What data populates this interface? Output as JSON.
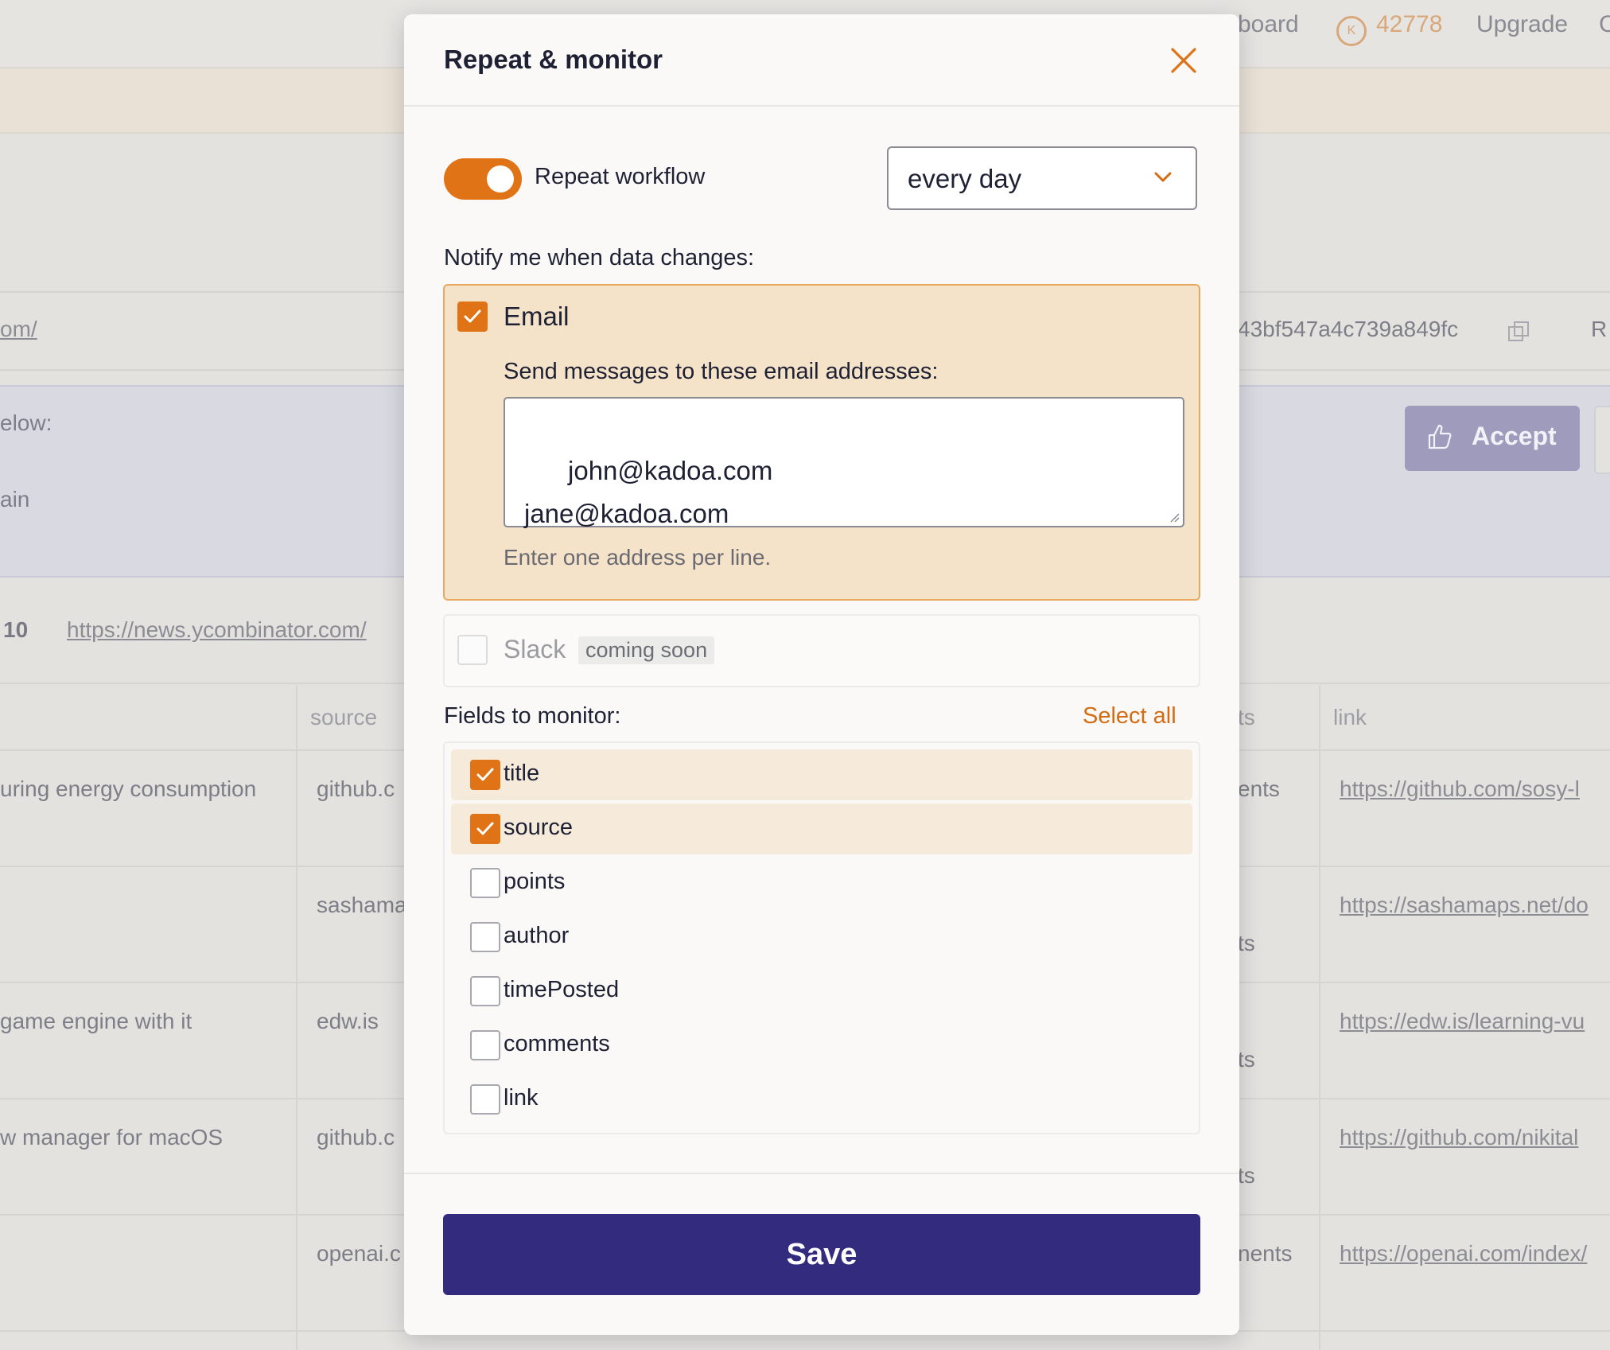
{
  "background": {
    "nav": {
      "dashboard_fragment": "board",
      "credits": "42778",
      "upgrade": "Upgrade",
      "edge_fragment": "C"
    },
    "url_fragment": "om/",
    "id_fragment": "43bf547a4c739a849fc",
    "right_fragment": "R",
    "below_fragment": "elow:",
    "ain_fragment": "ain",
    "accept_label": "Accept",
    "count_fragment": "10",
    "source_url": "https://news.ycombinator.com/",
    "table": {
      "headers": {
        "source": "source",
        "ts_fragment": "ts",
        "link": "link"
      },
      "rows": [
        {
          "title": "uring energy consumption",
          "source": "github.c",
          "mid": "ents",
          "link": "https://github.com/sosy-l"
        },
        {
          "title": "",
          "source": "sashama",
          "mid": "ts",
          "link": "https://sashamaps.net/do"
        },
        {
          "title": "game engine with it",
          "source": "edw.is",
          "mid": "ts",
          "link": "https://edw.is/learning-vu"
        },
        {
          "title": "w manager for macOS",
          "source": "github.c",
          "mid": "ts",
          "link": "https://github.com/nikital"
        },
        {
          "title": "",
          "source": "openai.c",
          "mid": "nents",
          "link": "https://openai.com/index/"
        }
      ]
    }
  },
  "modal": {
    "title": "Repeat & monitor",
    "repeat_label": "Repeat workflow",
    "repeat_enabled": true,
    "frequency": "every day",
    "notify_label": "Notify me when data changes:",
    "email": {
      "label": "Email",
      "checked": true,
      "send_label": "Send messages to these email addresses:",
      "addresses": "john@kadoa.com\njane@kadoa.com",
      "hint": "Enter one address per line."
    },
    "slack": {
      "label": "Slack",
      "badge": "coming soon",
      "checked": false
    },
    "fields_label": "Fields to monitor:",
    "select_all": "Select all",
    "fields": [
      {
        "name": "title",
        "checked": true
      },
      {
        "name": "source",
        "checked": true
      },
      {
        "name": "points",
        "checked": false
      },
      {
        "name": "author",
        "checked": false
      },
      {
        "name": "timePosted",
        "checked": false
      },
      {
        "name": "comments",
        "checked": false
      },
      {
        "name": "link",
        "checked": false
      }
    ],
    "save_label": "Save"
  },
  "colors": {
    "accent": "#e07316",
    "primary_button": "#322b7e",
    "email_panel": "#f5e3c9",
    "selected_field": "#f6eadb"
  }
}
